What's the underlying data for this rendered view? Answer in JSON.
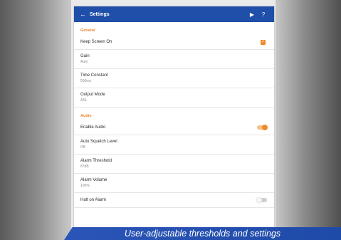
{
  "appbar": {
    "title": "Settings",
    "back_icon": "arrow-left-icon",
    "play_icon": "play-icon",
    "help_icon": "help-icon",
    "color": "#1f4fa8"
  },
  "sections": {
    "general": {
      "header": "General",
      "keep_screen_on": {
        "label": "Keep Screen On",
        "checked": true
      },
      "gain": {
        "label": "Gain",
        "value": "Auto"
      },
      "time_constant": {
        "label": "Time Constant",
        "value": "500ms"
      },
      "output_mode": {
        "label": "Output Mode",
        "value": "ASL"
      }
    },
    "audio": {
      "header": "Audio",
      "enable_audio": {
        "label": "Enable Audio",
        "on": true
      },
      "auto_squelch": {
        "label": "Auto Squelch Level",
        "value": "Off"
      },
      "alarm_threshold": {
        "label": "Alarm Threshold",
        "value": "87dB"
      },
      "alarm_volume": {
        "label": "Alarm Volume",
        "value": "100%"
      },
      "halt_on_alarm": {
        "label": "Halt on Alarm",
        "on": false
      }
    }
  },
  "accent_color": "#f08a24",
  "caption": "User-adjustable thresholds and settings"
}
